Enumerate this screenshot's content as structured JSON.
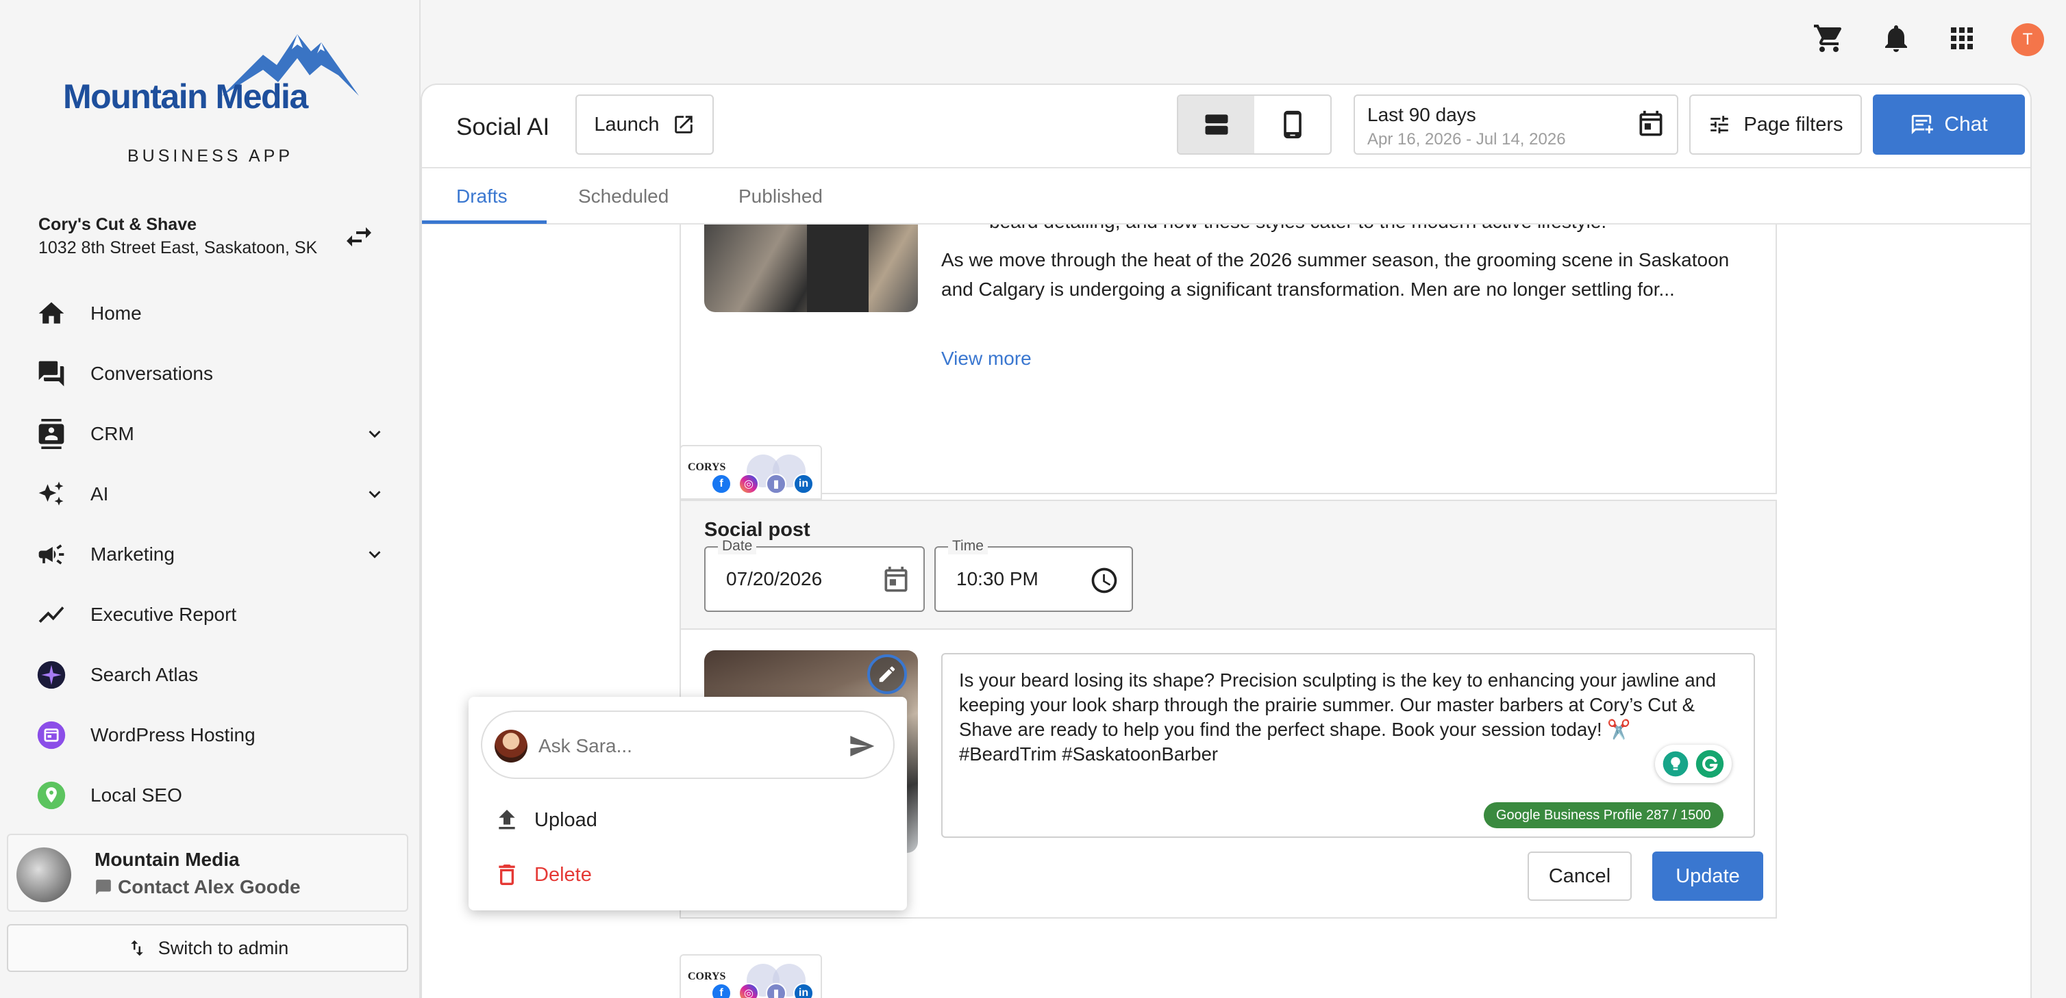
{
  "brand": {
    "logo_text": "Mountain Media",
    "subtitle": "BUSINESS APP"
  },
  "account": {
    "name": "Cory's Cut & Shave",
    "address": "1032 8th Street East, Saskatoon, SK"
  },
  "nav": {
    "items": [
      {
        "label": "Home",
        "icon": "home-icon"
      },
      {
        "label": "Conversations",
        "icon": "chat-bubbles-icon"
      },
      {
        "label": "CRM",
        "icon": "contact-card-icon",
        "expandable": true
      },
      {
        "label": "AI",
        "icon": "sparkles-icon",
        "expandable": true
      },
      {
        "label": "Marketing",
        "icon": "megaphone-icon",
        "expandable": true
      },
      {
        "label": "Executive Report",
        "icon": "trend-line-icon"
      },
      {
        "label": "Search Atlas",
        "icon": "search-atlas-icon"
      },
      {
        "label": "WordPress Hosting",
        "icon": "wordpress-hosting-icon"
      },
      {
        "label": "Local SEO",
        "icon": "location-pin-icon"
      }
    ]
  },
  "profile": {
    "name": "Mountain Media",
    "contact": "Contact Alex Goode"
  },
  "switch_admin": "Switch to admin",
  "topbar": {
    "avatar_initial": "T"
  },
  "header": {
    "title": "Social AI",
    "launch": "Launch",
    "date_range": "Last 90 days",
    "date_sub": "Apr 16, 2026 - Jul 14, 2026",
    "page_filters": "Page filters",
    "chat": "Chat"
  },
  "tabs": [
    "Drafts",
    "Scheduled",
    "Published"
  ],
  "post_preview": {
    "line1": "beard detailing, and how these styles cater to the modern active lifestyle.",
    "body": "As we move through the heat of the 2026 summer season, the grooming scene in Saskatoon and Calgary is undergoing a significant transformation. Men are no longer settling for...",
    "view_more": "View more"
  },
  "channel_badge": {
    "logo_text": "CORYS"
  },
  "editor": {
    "title": "Social post",
    "date_label": "Date",
    "date_value": "07/20/2026",
    "time_label": "Time",
    "time_value": "10:30 PM",
    "post_text": "Is your beard losing its shape? Precision sculpting is the key to enhancing your jawline and keeping your look sharp through the prairie summer. Our master barbers at Cory’s Cut & Shave are ready to help you find the perfect shape. Book your session today! ✂️\n#BeardTrim #SaskatoonBarber",
    "char_count": "Google Business Profile 287 / 1500",
    "cancel": "Cancel",
    "update": "Update"
  },
  "popup": {
    "ask_placeholder": "Ask Sara...",
    "upload": "Upload",
    "delete": "Delete"
  },
  "colors": {
    "primary": "#3a77d0",
    "brand_navy": "#1e4f9c",
    "danger": "#e53935",
    "success": "#3a8a3f",
    "avatar": "#f4754a"
  }
}
